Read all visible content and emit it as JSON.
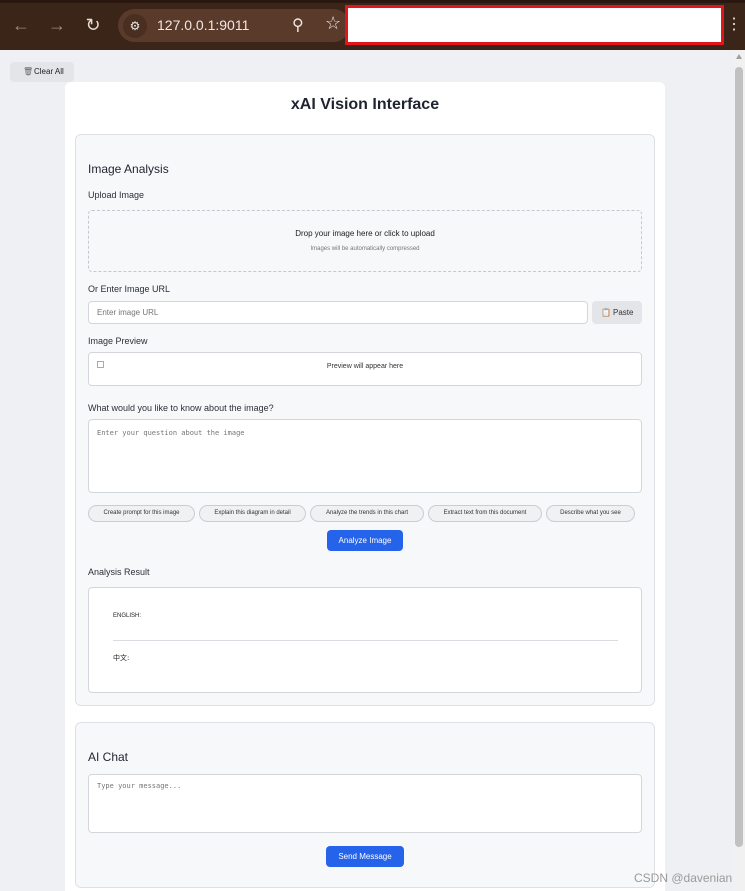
{
  "browser": {
    "url": "127.0.0.1:9011"
  },
  "toolbar": {
    "clear_all_label": "Clear All"
  },
  "page": {
    "title": "xAI Vision Interface"
  },
  "analysis": {
    "heading": "Image Analysis",
    "upload_label": "Upload Image",
    "dropzone_text": "Drop your image here or click to upload",
    "dropzone_subtext": "Images will be automatically compressed",
    "url_label": "Or Enter Image URL",
    "url_placeholder": "Enter image URL",
    "paste_label": "Paste",
    "preview_label": "Image Preview",
    "preview_placeholder": "Preview will appear here",
    "question_label": "What would you like to know about the image?",
    "question_placeholder": "Enter your question about the image",
    "chips": [
      "Create prompt for this image",
      "Explain this diagram in detail",
      "Analyze the trends in this chart",
      "Extract text from this document",
      "Describe what you see"
    ],
    "analyze_label": "Analyze Image",
    "result_label": "Analysis Result",
    "result_english": "ENGLISH:",
    "result_chinese": "中文:"
  },
  "chat": {
    "heading": "AI Chat",
    "input_placeholder": "Type your message...",
    "send_label": "Send Message"
  },
  "watermark": "CSDN @davenian",
  "colors": {
    "primary": "#2563eb",
    "chrome": "#3b2418",
    "highlight_box": "#e0161b"
  }
}
